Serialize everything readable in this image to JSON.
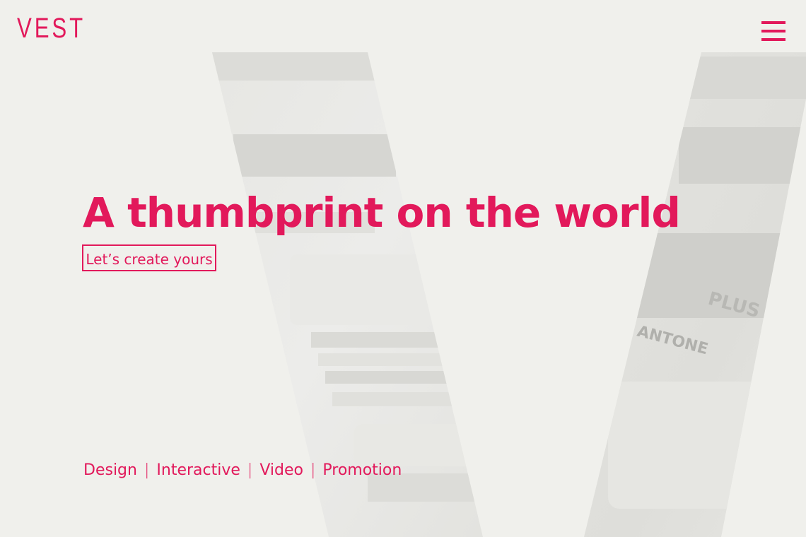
{
  "header": {
    "logo_text": "VEST",
    "menu_icon": "hamburger-menu-icon"
  },
  "hero": {
    "title": "A thumbprint on the world",
    "cta_label": "Let’s create yours"
  },
  "services": {
    "items": [
      "Design",
      "Interactive",
      "Video",
      "Promotion"
    ],
    "separator": "|"
  },
  "background": {
    "description_icon": "v-shaped-photo-strips",
    "print_text_plus": "THE PLUS SERIES",
    "print_text_brand": "PANTONE"
  },
  "colors": {
    "accent": "#e2195b",
    "background": "#f0f0ec"
  }
}
